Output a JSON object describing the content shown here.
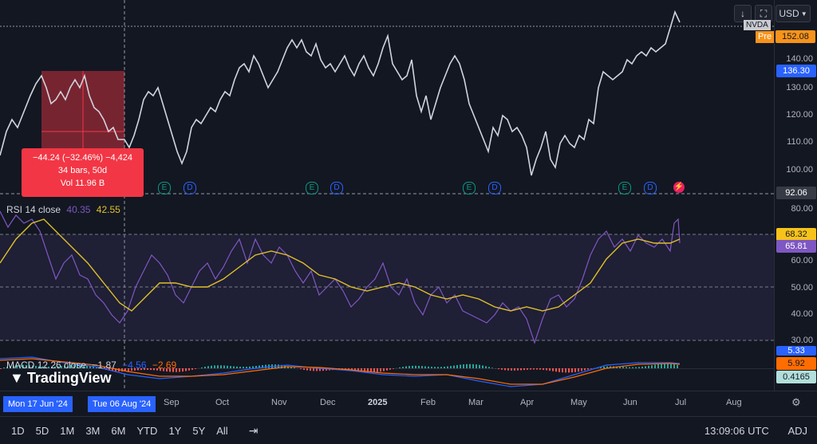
{
  "header": {
    "download_icon": "↓",
    "camera_icon": "⛶",
    "currency": "USD",
    "ticker": "NVDA",
    "pre_label": "Pre",
    "pre_price": "152.08"
  },
  "price_scale": {
    "ticks": [
      "140.00",
      "130.00",
      "120.00",
      "110.00",
      "100.00"
    ],
    "badge_blue": "136.30",
    "badge_dark": "92.06"
  },
  "tooltip": {
    "line1": "−44.24 (−32.46%) −4,424",
    "line2": "34 bars, 50d",
    "line3": "Vol 11.96 B"
  },
  "rsi": {
    "label": "RSI",
    "params": "14 close",
    "value1": "40.35",
    "value2": "42.55",
    "ticks": [
      "80.00",
      "60.00",
      "50.00",
      "40.00",
      "30.00"
    ],
    "badge_yellow": "68.32",
    "badge_purple": "65.81"
  },
  "macd": {
    "label": "MACD",
    "params": "12 26 close",
    "value1": "−1.87",
    "value2": "−4.56",
    "value3": "−2.69",
    "badge_top": "5.33",
    "badge_orange": "5.92",
    "badge_green": "0.4165"
  },
  "time_axis": {
    "ticks": [
      "Sep",
      "Oct",
      "Nov",
      "Dec",
      "2025",
      "Feb",
      "Mar",
      "Apr",
      "May",
      "Jun",
      "Jul",
      "Aug"
    ],
    "start_date": "Mon 17 Jun '24",
    "end_date": "Tue 06 Aug '24"
  },
  "bottom_bar": {
    "ranges": [
      "1D",
      "5D",
      "1M",
      "3M",
      "6M",
      "YTD",
      "1Y",
      "5Y",
      "All"
    ],
    "time": "13:09:06 UTC",
    "adj": "ADJ"
  },
  "logo": {
    "text": "TradingView"
  },
  "events": {
    "earnings": "E",
    "dividend": "D"
  },
  "colors": {
    "background": "#131722",
    "price_line": "#d1d4dc",
    "rsi_line": "#7e57c2",
    "rsi_ma": "#e0c02a",
    "macd_line": "#2962ff",
    "signal_line": "#ff6d00",
    "measure": "#f23645"
  }
}
